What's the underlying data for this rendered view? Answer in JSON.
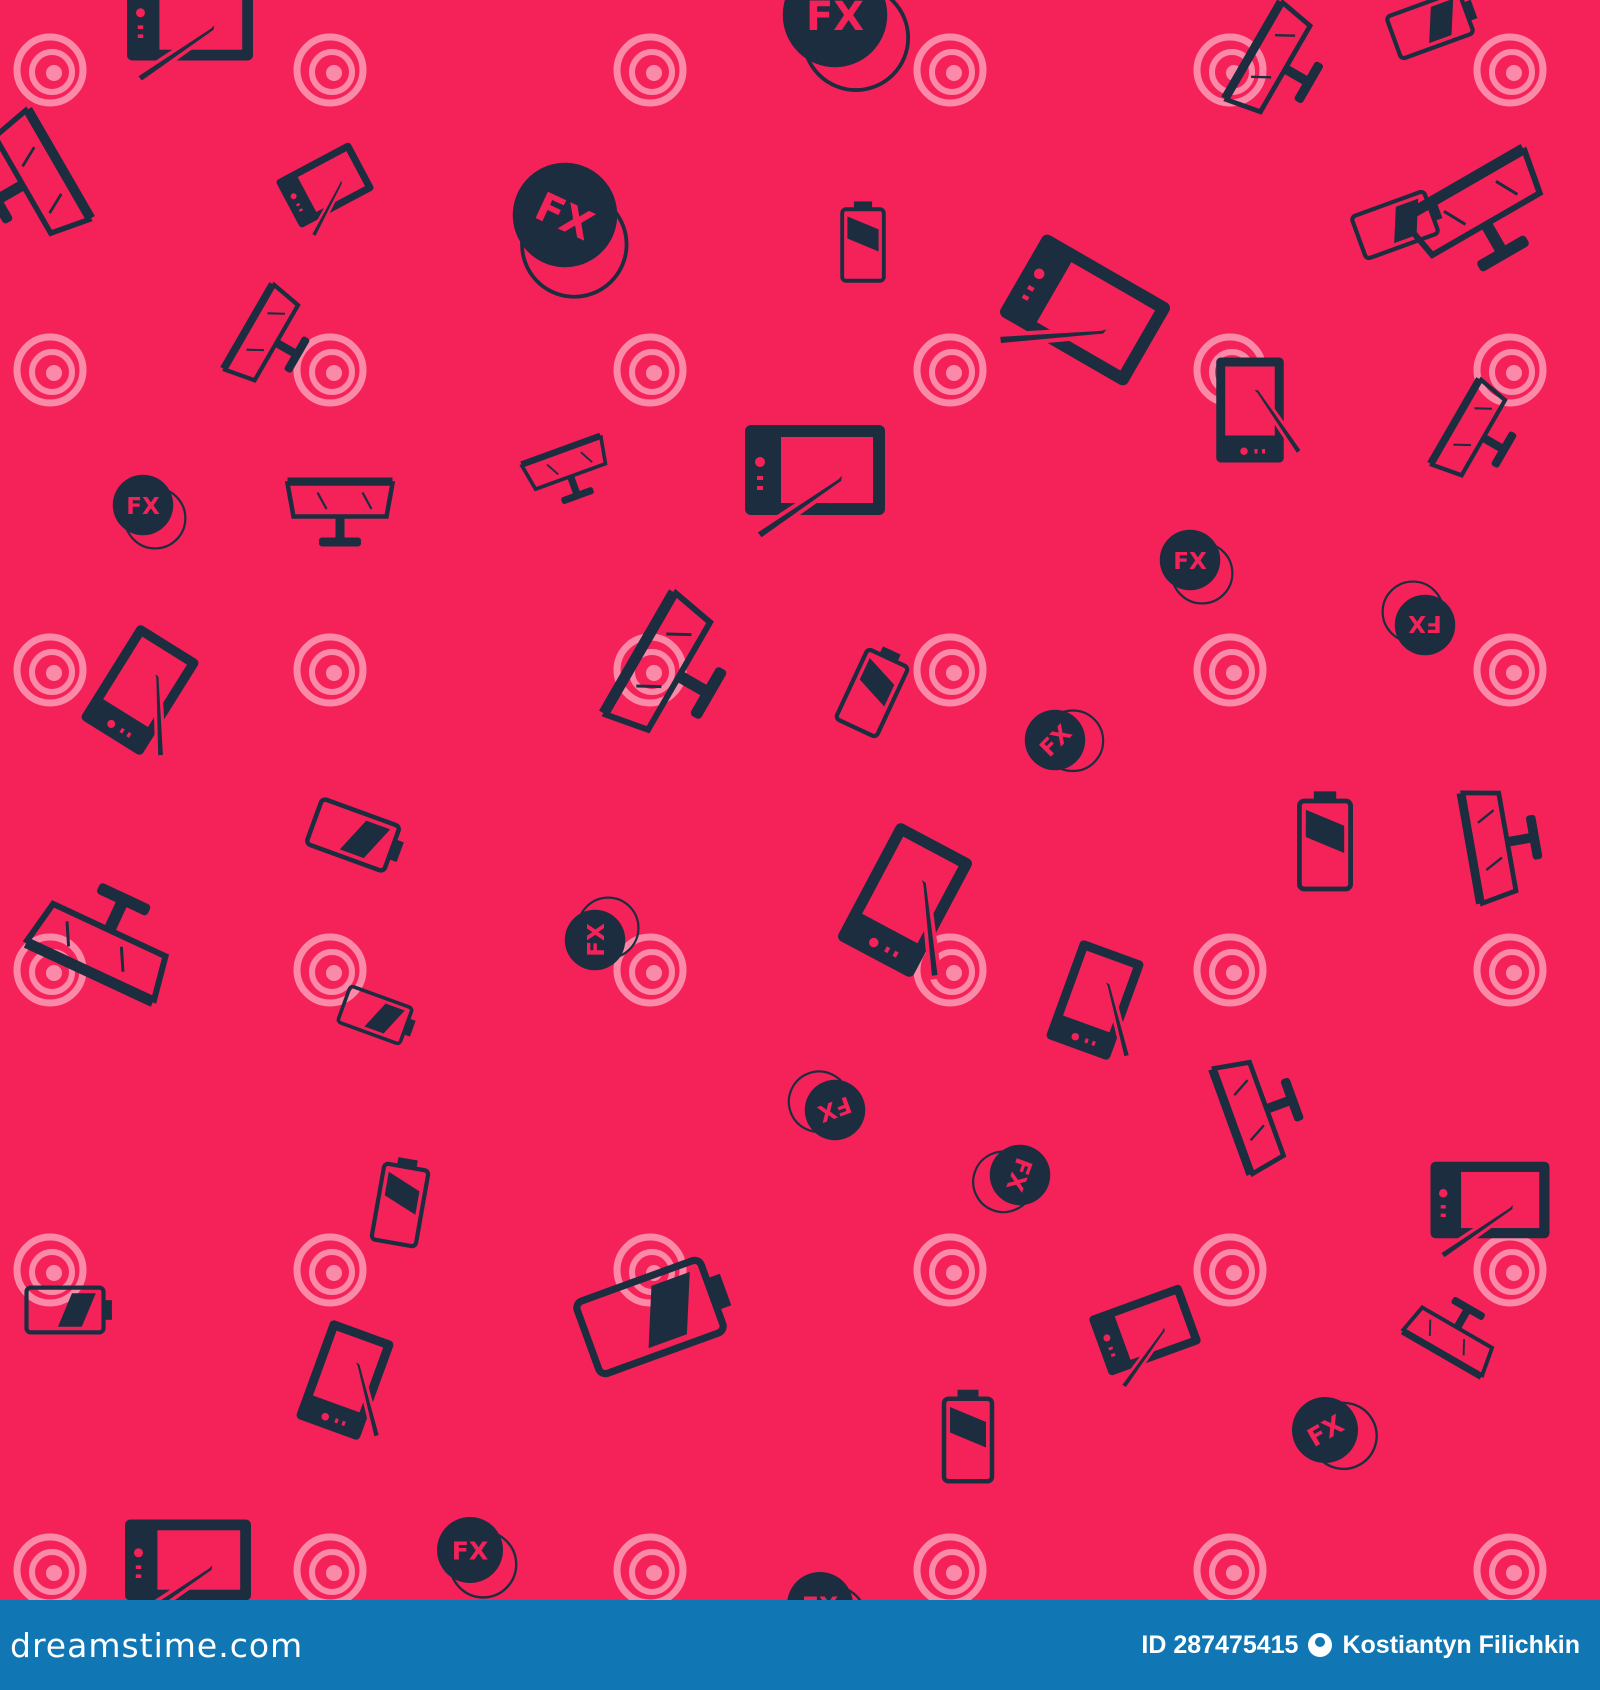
{
  "pattern": {
    "background_color": "#f5225a",
    "icon_color": "#1c2d3f",
    "icon_names": [
      "graphic-tablet-icon",
      "fx-effect-icon",
      "monitor-on-stand-icon",
      "battery-low-icon"
    ],
    "fx_label": "FX",
    "watermark": {
      "brand_text": "dreamstime",
      "logo_name": "dreamstime-spiral-logo"
    }
  },
  "footer": {
    "background_color": "#1177b4",
    "site": "dreamstime.com",
    "image_id": "ID 287475415",
    "author": "Kostiantyn Filichkin"
  }
}
